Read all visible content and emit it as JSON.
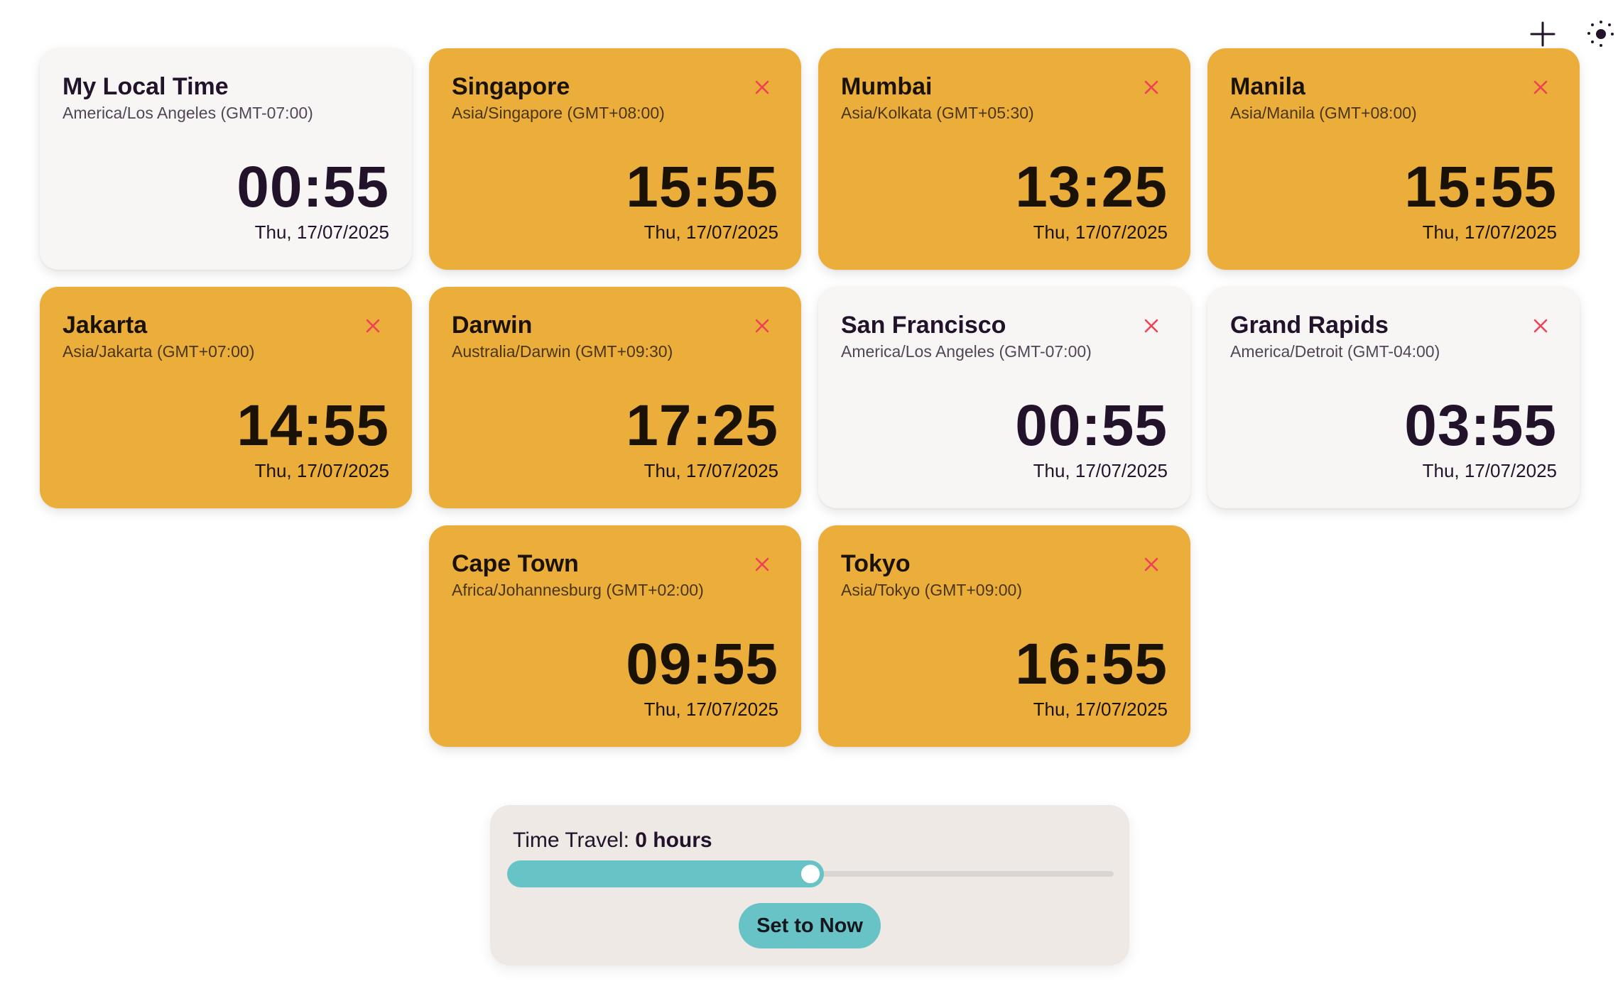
{
  "toolbar": {
    "add_icon": "plus-icon",
    "theme_icon": "dotted-sun-icon"
  },
  "colors": {
    "card_orange": "#ecae3a",
    "card_light": "#f7f6f5",
    "close_red": "#ef4057",
    "accent_teal": "#67c3c6",
    "panel_bg": "#eee9e5"
  },
  "clocks": [
    {
      "title": "My Local Time",
      "tz": "America/Los Angeles (GMT-07:00)",
      "time": "00:55",
      "date": "Thu, 17/07/2025",
      "variant": "light",
      "removable": false
    },
    {
      "title": "Singapore",
      "tz": "Asia/Singapore (GMT+08:00)",
      "time": "15:55",
      "date": "Thu, 17/07/2025",
      "variant": "orange",
      "removable": true
    },
    {
      "title": "Mumbai",
      "tz": "Asia/Kolkata (GMT+05:30)",
      "time": "13:25",
      "date": "Thu, 17/07/2025",
      "variant": "orange",
      "removable": true
    },
    {
      "title": "Manila",
      "tz": "Asia/Manila (GMT+08:00)",
      "time": "15:55",
      "date": "Thu, 17/07/2025",
      "variant": "orange",
      "removable": true
    },
    {
      "title": "Jakarta",
      "tz": "Asia/Jakarta (GMT+07:00)",
      "time": "14:55",
      "date": "Thu, 17/07/2025",
      "variant": "orange",
      "removable": true
    },
    {
      "title": "Darwin",
      "tz": "Australia/Darwin (GMT+09:30)",
      "time": "17:25",
      "date": "Thu, 17/07/2025",
      "variant": "orange",
      "removable": true
    },
    {
      "title": "San Francisco",
      "tz": "America/Los Angeles (GMT-07:00)",
      "time": "00:55",
      "date": "Thu, 17/07/2025",
      "variant": "light",
      "removable": true
    },
    {
      "title": "Grand Rapids",
      "tz": "America/Detroit (GMT-04:00)",
      "time": "03:55",
      "date": "Thu, 17/07/2025",
      "variant": "light",
      "removable": true
    },
    {
      "title": "Cape Town",
      "tz": "Africa/Johannesburg (GMT+02:00)",
      "time": "09:55",
      "date": "Thu, 17/07/2025",
      "variant": "orange",
      "removable": true
    },
    {
      "title": "Tokyo",
      "tz": "Asia/Tokyo (GMT+09:00)",
      "time": "16:55",
      "date": "Thu, 17/07/2025",
      "variant": "orange",
      "removable": true
    }
  ],
  "time_travel": {
    "label": "Time Travel:",
    "value": "0 hours",
    "slider_fraction": 0.5,
    "set_now_label": "Set to Now"
  }
}
